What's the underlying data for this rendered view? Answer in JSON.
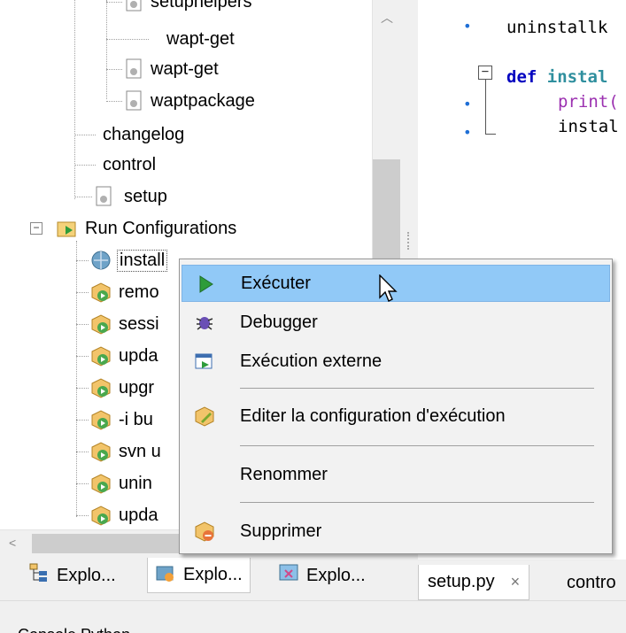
{
  "tree": {
    "items": [
      {
        "label": "setuphelpers"
      },
      {
        "label": "wapt-get"
      },
      {
        "label": "wapt-get"
      },
      {
        "label": "waptpackage"
      },
      {
        "label": "changelog"
      },
      {
        "label": "control"
      },
      {
        "label": "setup"
      },
      {
        "label": "Run Configurations"
      },
      {
        "label": "install"
      },
      {
        "label": "remo"
      },
      {
        "label": "sessi"
      },
      {
        "label": "upda"
      },
      {
        "label": "upgr"
      },
      {
        "label": "-i bu"
      },
      {
        "label": "svn u"
      },
      {
        "label": "unin"
      },
      {
        "label": "upda"
      }
    ]
  },
  "editor": {
    "line1": "uninstallk",
    "line2_kw": "def",
    "line2_fn": "instal",
    "line3": "print(",
    "line4": "instal"
  },
  "context_menu": {
    "items": [
      {
        "label": "Exécuter",
        "icon": "play-icon",
        "highlighted": true
      },
      {
        "label": "Debugger",
        "icon": "debug-bug-icon"
      },
      {
        "label": "Exécution externe",
        "icon": "external-run-icon"
      },
      {
        "label": "Editer la configuration d'exécution",
        "icon": "edit-config-icon"
      },
      {
        "label": "Renommer",
        "icon": ""
      },
      {
        "label": "Supprimer",
        "icon": "delete-package-icon"
      }
    ]
  },
  "left_tabs": [
    {
      "label": "Explo..."
    },
    {
      "label": "Explo..."
    },
    {
      "label": "Explo..."
    }
  ],
  "right_tabs": [
    {
      "label": "setup.py",
      "close": "×"
    },
    {
      "label": "contro"
    }
  ],
  "bottom": {
    "text": "Console Python"
  },
  "colors": {
    "highlight": "#91c9f7",
    "keyword": "#0000c0",
    "function": "#2f8f9e",
    "print": "#9b30b0",
    "bullet": "#1f6fd6"
  }
}
